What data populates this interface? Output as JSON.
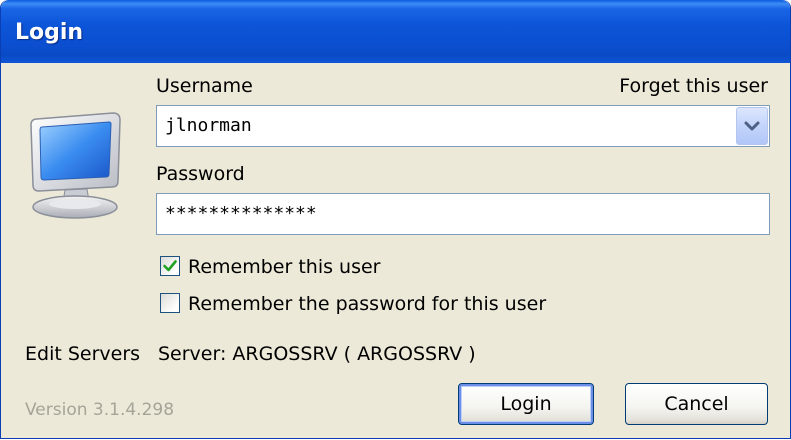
{
  "window": {
    "title": "Login"
  },
  "icons": {
    "app_icon": "computer-monitor-icon",
    "combo_arrow": "chevron-down-icon",
    "check_mark": "check-icon"
  },
  "username": {
    "label": "Username",
    "value": "jlnorman",
    "forget_link": "Forget this user"
  },
  "password": {
    "label": "Password",
    "value": "**************"
  },
  "options": {
    "remember_user": {
      "label": "Remember this user",
      "checked": true
    },
    "remember_password": {
      "label": "Remember the password for this user",
      "checked": false
    }
  },
  "server": {
    "edit_link": "Edit Servers",
    "text": "Server: ARGOSSRV ( ARGOSSRV )"
  },
  "footer": {
    "version": "Version 3.1.4.298",
    "login_label": "Login",
    "cancel_label": "Cancel"
  },
  "colors": {
    "titlebar": "#0b4fd0",
    "dialog_bg": "#ece9d8",
    "field_border": "#7f9db9",
    "check_green": "#21a121",
    "version_gray": "#a5a497"
  }
}
